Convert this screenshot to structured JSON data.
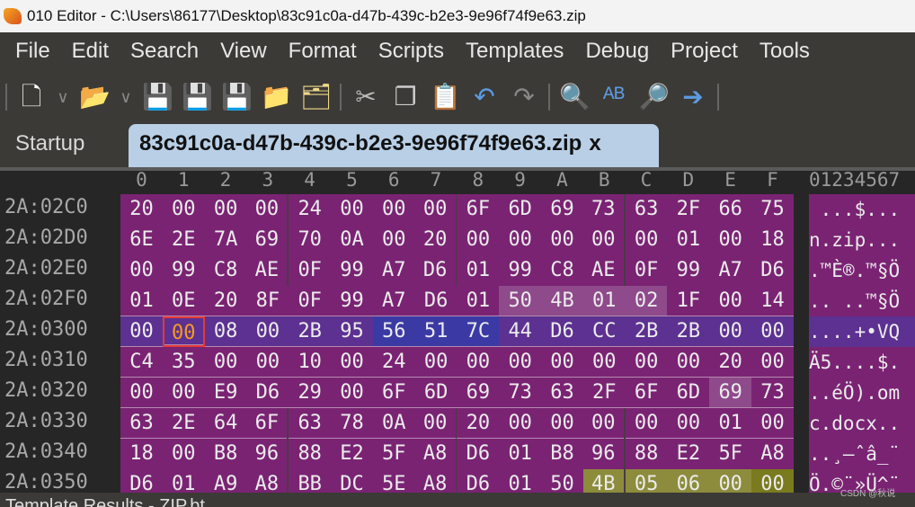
{
  "window": {
    "title": "010 Editor - C:\\Users\\86177\\Desktop\\83c91c0a-d47b-439c-b2e3-9e96f74f9e63.zip"
  },
  "menu": [
    "File",
    "Edit",
    "Search",
    "View",
    "Format",
    "Scripts",
    "Templates",
    "Debug",
    "Project",
    "Tools"
  ],
  "toolbar": [
    {
      "name": "new-file-icon",
      "glyph": "🗋",
      "color": "#ffffff"
    },
    {
      "name": "open-folder-icon",
      "glyph": "📂",
      "color": "#f0d98a"
    },
    {
      "name": "save-icon",
      "glyph": "💾",
      "color": "#5c9be0"
    },
    {
      "name": "save-as-icon",
      "glyph": "💾",
      "color": "#5c9be0"
    },
    {
      "name": "save-all-icon",
      "glyph": "💾",
      "color": "#5c9be0"
    },
    {
      "name": "folder-icon",
      "glyph": "📁",
      "color": "#f0d98a"
    },
    {
      "name": "folders-icon",
      "glyph": "🗂",
      "color": "#f0d98a"
    },
    {
      "name": "cut-icon",
      "glyph": "✂",
      "color": "#bbbbbb"
    },
    {
      "name": "copy-icon",
      "glyph": "❐",
      "color": "#cccccc"
    },
    {
      "name": "paste-icon",
      "glyph": "📋",
      "color": "#f0d98a"
    },
    {
      "name": "undo-icon",
      "glyph": "↶",
      "color": "#5c9be0"
    },
    {
      "name": "redo-icon",
      "glyph": "↷",
      "color": "#888888"
    },
    {
      "name": "find-icon",
      "glyph": "🔍",
      "color": "#ffffff"
    },
    {
      "name": "replace-icon",
      "glyph": "ᴬᴮ",
      "color": "#5c9be0"
    },
    {
      "name": "find-in-files-icon",
      "glyph": "🔎",
      "color": "#f0d98a"
    },
    {
      "name": "goto-icon",
      "glyph": "➔",
      "color": "#5c9be0"
    }
  ],
  "tabs": {
    "startup": "Startup",
    "active": "83c91c0a-d47b-439c-b2e3-9e96f74f9e63.zip",
    "close": "x"
  },
  "hex": {
    "columns": [
      "0",
      "1",
      "2",
      "3",
      "4",
      "5",
      "6",
      "7",
      "8",
      "9",
      "A",
      "B",
      "C",
      "D",
      "E",
      "F"
    ],
    "ascii_header": "01234567",
    "rows": [
      {
        "addr": "2A:02C0",
        "bytes": [
          "20",
          "00",
          "00",
          "00",
          "24",
          "00",
          "00",
          "00",
          "6F",
          "6D",
          "69",
          "73",
          "63",
          "2F",
          "66",
          "75"
        ],
        "ascii": " ...$..."
      },
      {
        "addr": "2A:02D0",
        "bytes": [
          "6E",
          "2E",
          "7A",
          "69",
          "70",
          "0A",
          "00",
          "20",
          "00",
          "00",
          "00",
          "00",
          "00",
          "01",
          "00",
          "18"
        ],
        "ascii": "n.zip..."
      },
      {
        "addr": "2A:02E0",
        "bytes": [
          "00",
          "99",
          "C8",
          "AE",
          "0F",
          "99",
          "A7",
          "D6",
          "01",
          "99",
          "C8",
          "AE",
          "0F",
          "99",
          "A7",
          "D6"
        ],
        "ascii": ".™È®.™§Ö"
      },
      {
        "addr": "2A:02F0",
        "bytes": [
          "01",
          "0E",
          "20",
          "8F",
          "0F",
          "99",
          "A7",
          "D6",
          "01",
          "50",
          "4B",
          "01",
          "02",
          "1F",
          "00",
          "14"
        ],
        "ascii": ".. ..™§Ö"
      },
      {
        "addr": "2A:0300",
        "bytes": [
          "00",
          "00",
          "08",
          "00",
          "2B",
          "95",
          "56",
          "51",
          "7C",
          "44",
          "D6",
          "CC",
          "2B",
          "2B",
          "00",
          "00"
        ],
        "ascii": "....+•VQ"
      },
      {
        "addr": "2A:0310",
        "bytes": [
          "C4",
          "35",
          "00",
          "00",
          "10",
          "00",
          "24",
          "00",
          "00",
          "00",
          "00",
          "00",
          "00",
          "00",
          "20",
          "00"
        ],
        "ascii": "Ä5....$."
      },
      {
        "addr": "2A:0320",
        "bytes": [
          "00",
          "00",
          "E9",
          "D6",
          "29",
          "00",
          "6F",
          "6D",
          "69",
          "73",
          "63",
          "2F",
          "6F",
          "6D",
          "69",
          "73"
        ],
        "ascii": "..éÖ).om"
      },
      {
        "addr": "2A:0330",
        "bytes": [
          "63",
          "2E",
          "64",
          "6F",
          "63",
          "78",
          "0A",
          "00",
          "20",
          "00",
          "00",
          "00",
          "00",
          "00",
          "01",
          "00"
        ],
        "ascii": "c.docx.."
      },
      {
        "addr": "2A:0340",
        "bytes": [
          "18",
          "00",
          "B8",
          "96",
          "88",
          "E2",
          "5F",
          "A8",
          "D6",
          "01",
          "B8",
          "96",
          "88",
          "E2",
          "5F",
          "A8"
        ],
        "ascii": "..¸–ˆâ_¨"
      },
      {
        "addr": "2A:0350",
        "bytes": [
          "D6",
          "01",
          "A9",
          "A8",
          "BB",
          "DC",
          "5E",
          "A8",
          "D6",
          "01",
          "50",
          "4B",
          "05",
          "06",
          "00",
          "00"
        ],
        "ascii": "Ö.©¨»Ü^¨"
      }
    ]
  },
  "colors": {
    "data": "#7a2373",
    "struct_highlight": "#8e4a8a",
    "selected_row": "#5c3191",
    "selected_field": "#3b3aa5",
    "eocd": "#8c8c3c",
    "cursor_text": "#f59a23",
    "cursor_border": "#e53935"
  },
  "statusbar": {
    "panel": "Template Results - ZIP.bt"
  },
  "watermark": "CSDN @秋说"
}
